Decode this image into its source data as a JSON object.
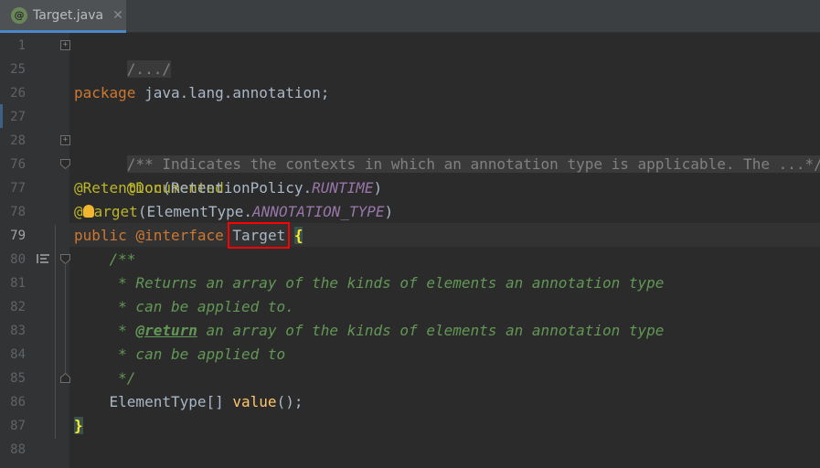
{
  "tab": {
    "icon": "@",
    "label": "Target.java",
    "close": "✕"
  },
  "gutter": [
    "1",
    "25",
    "26",
    "27",
    "28",
    "76",
    "77",
    "78",
    "79",
    "80",
    "81",
    "82",
    "83",
    "84",
    "85",
    "86",
    "87",
    "88"
  ],
  "code": {
    "l1": "/.../",
    "l26_kw": "package",
    "l26_rest": " java.lang.annotation;",
    "l28": "/** Indicates the contexts in which an annotation type is applicable. The ...*/",
    "l76": "@Documented",
    "l77_ann": "@Retention",
    "l77_a": "(RetentionPolicy.",
    "l77_const": "RUNTIME",
    "l77_b": ")",
    "l78_ann_a": "@",
    "l78_ann_b": "arget",
    "l78_a": "(ElementType.",
    "l78_const": "ANNOTATION_TYPE",
    "l78_b": ")",
    "l79_public": "public",
    "l79_iface": "@interface",
    "l79_name": "Target",
    "l79_brace": "{",
    "l80": "    /**",
    "l81": "     * Returns an array of the kinds of elements an annotation type",
    "l82": "     * can be applied to.",
    "l83_a": "     * ",
    "l83_tag": "@return",
    "l83_b": " an array of the kinds of elements an annotation type",
    "l84": "     * can be applied to",
    "l85": "     */",
    "l86_a": "    ElementType[] ",
    "l86_m": "value",
    "l86_b": "();",
    "l87": "}"
  }
}
